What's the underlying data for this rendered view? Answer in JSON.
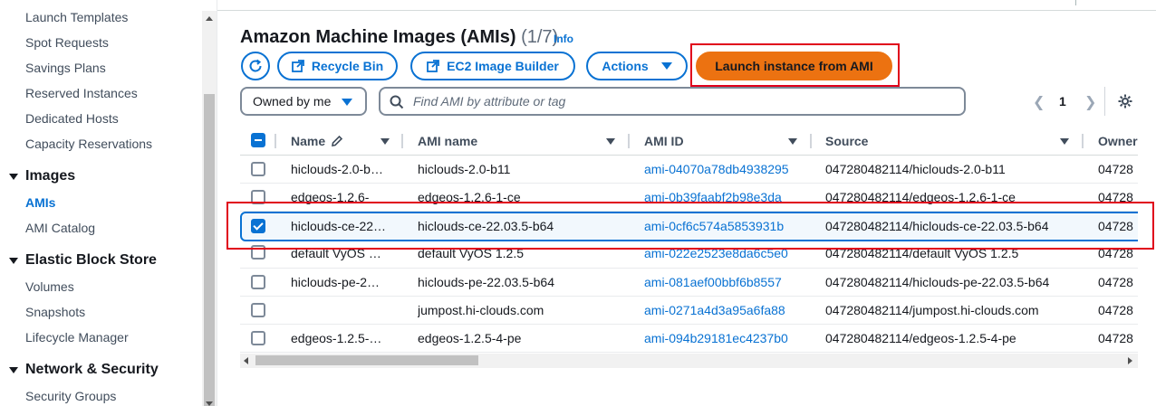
{
  "sidebar": {
    "items": [
      {
        "label": "Launch Templates"
      },
      {
        "label": "Spot Requests"
      },
      {
        "label": "Savings Plans"
      },
      {
        "label": "Reserved Instances"
      },
      {
        "label": "Dedicated Hosts"
      },
      {
        "label": "Capacity Reservations"
      }
    ],
    "images_section": {
      "title": "Images",
      "items": [
        {
          "label": "AMIs",
          "active": true
        },
        {
          "label": "AMI Catalog"
        }
      ]
    },
    "ebs_section": {
      "title": "Elastic Block Store",
      "items": [
        {
          "label": "Volumes"
        },
        {
          "label": "Snapshots"
        },
        {
          "label": "Lifecycle Manager"
        }
      ]
    },
    "network_section": {
      "title": "Network & Security",
      "items": [
        {
          "label": "Security Groups"
        }
      ]
    }
  },
  "header": {
    "title": "Amazon Machine Images (AMIs)",
    "count": "(1/7)",
    "info": "Info"
  },
  "toolbar": {
    "refresh_icon": "refresh-icon",
    "recycle_bin": "Recycle Bin",
    "image_builder": "EC2 Image Builder",
    "actions": "Actions",
    "launch": "Launch instance from AMI"
  },
  "filter": {
    "owner_selected": "Owned by me",
    "search_placeholder": "Find AMI by attribute or tag"
  },
  "pagination": {
    "current_page": "1"
  },
  "colors": {
    "accent": "#0972d3",
    "primary_button": "#ec7211",
    "highlight": "#e0001b"
  },
  "table": {
    "columns": {
      "name": "Name",
      "ami_name": "AMI name",
      "ami_id": "AMI ID",
      "source": "Source",
      "owner": "Owner"
    },
    "rows": [
      {
        "name": "hiclouds-2.0-b…",
        "ami_name": "hiclouds-2.0-b11",
        "ami_id": "ami-04070a78db4938295",
        "source": "047280482114/hiclouds-2.0-b11",
        "owner": "04728",
        "checked": false
      },
      {
        "name": "edgeos-1.2.6-",
        "ami_name": "edgeos-1.2.6-1-ce",
        "ami_id": "ami-0b39faabf2b98e3da",
        "source": "047280482114/edgeos-1.2.6-1-ce",
        "owner": "04728",
        "checked": false
      },
      {
        "name": "hiclouds-ce-22…",
        "ami_name": "hiclouds-ce-22.03.5-b64",
        "ami_id": "ami-0cf6c574a5853931b",
        "source": "047280482114/hiclouds-ce-22.03.5-b64",
        "owner": "04728",
        "checked": true
      },
      {
        "name": "default VyOS …",
        "ami_name": "default VyOS 1.2.5",
        "ami_id": "ami-022e2523e8da6c5e0",
        "source": "047280482114/default VyOS 1.2.5",
        "owner": "04728",
        "checked": false
      },
      {
        "name": "hiclouds-pe-2…",
        "ami_name": "hiclouds-pe-22.03.5-b64",
        "ami_id": "ami-081aef00bbf6b8557",
        "source": "047280482114/hiclouds-pe-22.03.5-b64",
        "owner": "04728",
        "checked": false
      },
      {
        "name": "",
        "ami_name": "jumpost.hi-clouds.com",
        "ami_id": "ami-0271a4d3a95a6fa88",
        "source": "047280482114/jumpost.hi-clouds.com",
        "owner": "04728",
        "checked": false
      },
      {
        "name": "edgeos-1.2.5-…",
        "ami_name": "edgeos-1.2.5-4-pe",
        "ami_id": "ami-094b29181ec4237b0",
        "source": "047280482114/edgeos-1.2.5-4-pe",
        "owner": "04728",
        "checked": false
      }
    ]
  }
}
